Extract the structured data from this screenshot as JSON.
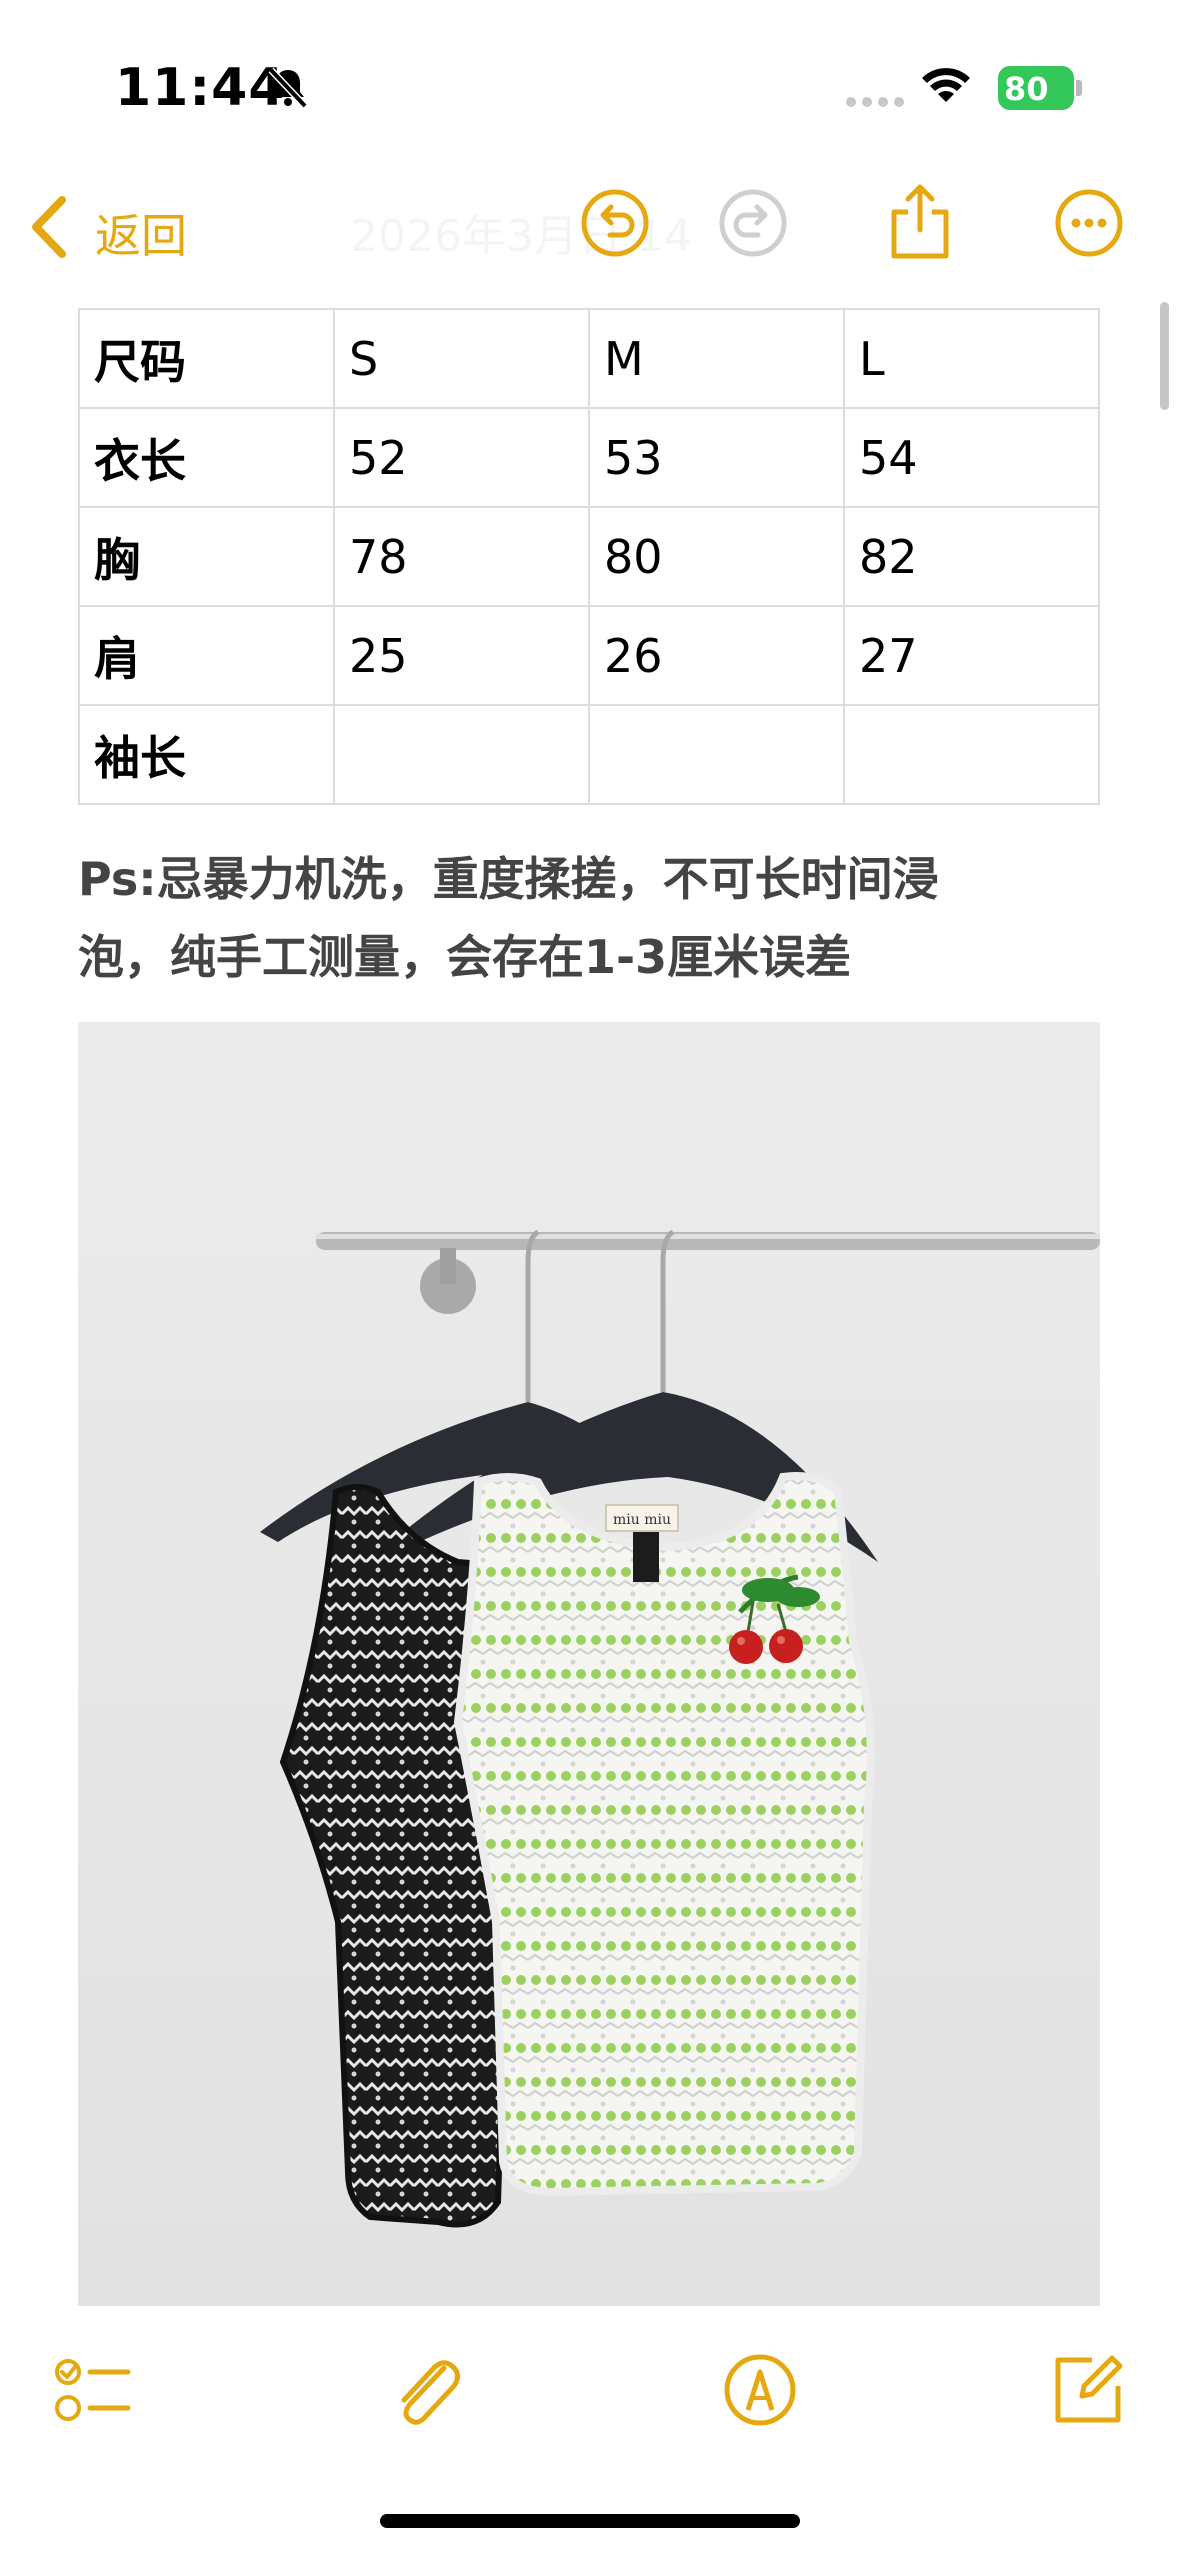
{
  "status_bar": {
    "time": "11:44",
    "battery_percent": "80",
    "icons": [
      "bell-slash-icon",
      "cellular-signal-icon",
      "wifi-icon",
      "battery-charging-icon"
    ]
  },
  "nav": {
    "back_label": "返回",
    "date_title": "2026年3月日 14",
    "icons": [
      "chevron-left-icon",
      "undo-icon",
      "redo-icon",
      "share-icon",
      "more-icon"
    ]
  },
  "size_table": {
    "rows": [
      [
        "尺码",
        "S",
        "M",
        "L"
      ],
      [
        "衣长",
        "52",
        "53",
        "54"
      ],
      [
        "胸",
        "78",
        "80",
        "82"
      ],
      [
        "肩",
        "25",
        "26",
        "27"
      ],
      [
        "袖长",
        "",
        "",
        ""
      ]
    ]
  },
  "note": {
    "line1": "Ps:忌暴力机洗，重度揉搓，不可长时间浸",
    "line2": "泡，纯手工测量，会存在1-3厘米误差"
  },
  "photo": {
    "label_text": "miu miu"
  },
  "toolbar": {
    "icons": [
      "checklist-icon",
      "paperclip-icon",
      "markup-pen-icon",
      "compose-icon"
    ]
  },
  "colors": {
    "accent": "#e5a811",
    "battery": "#34c759",
    "note_text": "#444444",
    "table_border": "#dcdcdc"
  }
}
